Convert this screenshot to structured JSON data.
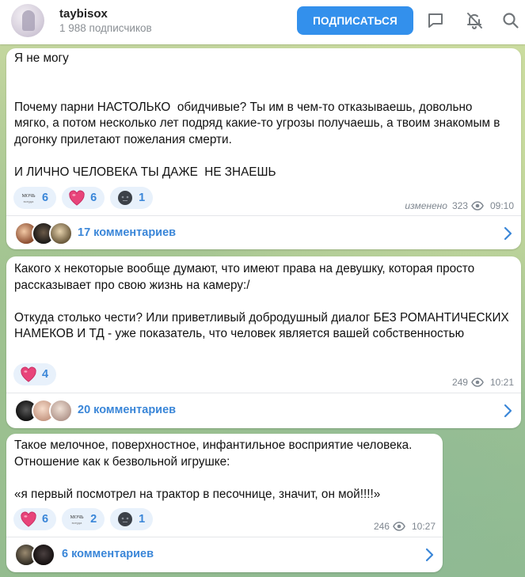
{
  "header": {
    "channel_name": "taybisox",
    "subscribers": "1 988 подписчиков",
    "subscribe_label": "ПОДПИСАТЬСЯ",
    "icons": [
      "comment-icon",
      "bell-muted-icon",
      "search-icon"
    ]
  },
  "posts": [
    {
      "text": "Я не могу\n\n\nПочему парни НАСТОЛЬКО  обидчивые? Ты им в чем-то отказываешь, довольно мягко, а потом несколько лет подряд какие-то угрозы получаешь, а твоим знакомым в догонку прилетают пожелания смерти.\n\nИ ЛИЧНО ЧЕЛОВЕКА ТЫ ДАЖЕ  НЕ ЗНАЕШЬ",
      "reactions": [
        {
          "emoji": "sticker",
          "count": "6"
        },
        {
          "emoji": "heart",
          "count": "6"
        },
        {
          "emoji": "new-moon-face",
          "count": "1"
        }
      ],
      "edited": "изменено",
      "views": "323",
      "time": "09:10",
      "comments": "17 комментариев"
    },
    {
      "text": "Какого х некоторые вообще думают, что имеют права на девушку, которая просто рассказывает про свою жизнь на камеру:/\n\nОткуда столько чести? Или приветливый добродушный диалог БЕЗ РОМАНТИЧЕСКИХ НАМЕКОВ И ТД - уже показатель, что человек является вашей собственностью",
      "reactions": [
        {
          "emoji": "heart",
          "count": "4"
        }
      ],
      "views": "249",
      "time": "10:21",
      "comments": "20 комментариев"
    },
    {
      "text": "Такое мелочное, поверхностное, инфантильное восприятие человека. Отношение как к безвольной игрушке:\n\n«я первый посмотрел на трактор в песочнице, значит, он мой!!!!»",
      "reactions": [
        {
          "emoji": "heart",
          "count": "6"
        },
        {
          "emoji": "sticker",
          "count": "2"
        },
        {
          "emoji": "new-moon-face",
          "count": "1"
        }
      ],
      "views": "246",
      "time": "10:27",
      "comments": "6 комментариев"
    }
  ],
  "sticker_text": "МОЧЬ\nвсеуда",
  "colors": {
    "accent": "#3390ec",
    "link": "#3a86d8",
    "reaction_bg": "#e8f1fb",
    "meta": "#7f8790"
  }
}
